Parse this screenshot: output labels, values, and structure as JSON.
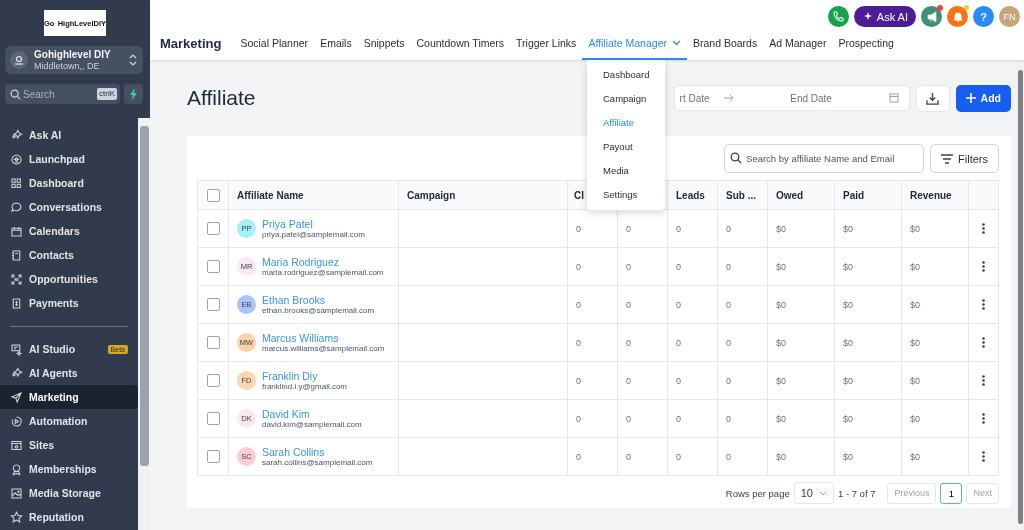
{
  "sidebar": {
    "logo": {
      "left": "Go",
      "right": "HighLevelDIY"
    },
    "account": {
      "name": "Gohighlevel DIY",
      "location": "Middletown,, DE"
    },
    "search": {
      "placeholder": "Search",
      "shortcut": "ctrlK"
    },
    "groups": [
      [
        {
          "label": "Ask AI",
          "selected": false
        },
        {
          "label": "Launchpad",
          "selected": false
        },
        {
          "label": "Dashboard",
          "selected": false
        },
        {
          "label": "Conversations",
          "selected": false
        },
        {
          "label": "Calendars",
          "selected": false
        },
        {
          "label": "Contacts",
          "selected": false
        },
        {
          "label": "Opportunities",
          "selected": false
        },
        {
          "label": "Payments",
          "selected": false
        }
      ],
      [
        {
          "label": "AI Studio",
          "selected": false,
          "badge": "Beta"
        },
        {
          "label": "AI Agents",
          "selected": false
        },
        {
          "label": "Marketing",
          "selected": true
        },
        {
          "label": "Automation",
          "selected": false
        },
        {
          "label": "Sites",
          "selected": false
        },
        {
          "label": "Memberships",
          "selected": false
        },
        {
          "label": "Media Storage",
          "selected": false
        },
        {
          "label": "Reputation",
          "selected": false
        }
      ]
    ]
  },
  "topbar": {
    "ask_ai": "Ask AI",
    "help": "?",
    "avatar": "FN",
    "notifications": [
      {
        "kind": "megaphone",
        "unread": true
      },
      {
        "kind": "bell",
        "unread": true
      }
    ]
  },
  "nav": {
    "title": "Marketing",
    "tabs": [
      {
        "label": "Social Planner",
        "selected": false
      },
      {
        "label": "Emails",
        "selected": false
      },
      {
        "label": "Snippets",
        "selected": false
      },
      {
        "label": "Countdown Timers",
        "selected": false
      },
      {
        "label": "Trigger Links",
        "selected": false
      },
      {
        "label": "Affiliate Manager",
        "selected": true,
        "dropdown": true
      },
      {
        "label": "Brand Boards",
        "selected": false
      },
      {
        "label": "Ad Manager",
        "selected": false
      },
      {
        "label": "Prospecting",
        "selected": false
      }
    ]
  },
  "dropdown_menu": [
    {
      "label": "Dashboard",
      "selected": false
    },
    {
      "label": "Campaign",
      "selected": false
    },
    {
      "label": "Affiliate",
      "selected": true
    },
    {
      "label": "Payout",
      "selected": false
    },
    {
      "label": "Media",
      "selected": false
    },
    {
      "label": "Settings",
      "selected": false
    }
  ],
  "page": {
    "title": "Affiliate",
    "start_date": "rt Date",
    "end_date": "End Date",
    "add_button": "Add"
  },
  "table": {
    "search": {
      "placeholder": "Search by affiliate Name and Email"
    },
    "filters": "Filters",
    "header_checked": false,
    "name_column": "Affiliate Name",
    "columns": [
      "Campaign",
      "Cl",
      "",
      "Leads",
      "Sub ...",
      "Owed",
      "Paid",
      "Revenue"
    ],
    "rows": [
      {
        "initials": "PP",
        "color": "#a5effa",
        "name": "Priya Patel",
        "email": "priya.patel@samplemail.com",
        "checked": false,
        "cells": [
          "",
          "0",
          "0",
          "0",
          "0",
          "$0",
          "$0",
          "$0"
        ]
      },
      {
        "initials": "MR",
        "color": "#fce7f3",
        "name": "Maria Rodriguez",
        "email": "maria.rodriguez@samplemail.com",
        "checked": false,
        "cells": [
          "",
          "0",
          "0",
          "0",
          "0",
          "$0",
          "$0",
          "$0"
        ]
      },
      {
        "initials": "EB",
        "color": "#a9c5fa",
        "name": "Ethan Brooks",
        "email": "ethan.brooks@samplemail.com",
        "checked": false,
        "cells": [
          "",
          "0",
          "0",
          "0",
          "0",
          "$0",
          "$0",
          "$0"
        ]
      },
      {
        "initials": "MW",
        "color": "#fdd2a7",
        "name": "Marcus Williams",
        "email": "marcus.williams@samplemail.com",
        "checked": false,
        "cells": [
          "",
          "0",
          "0",
          "0",
          "0",
          "$0",
          "$0",
          "$0"
        ]
      },
      {
        "initials": "FD",
        "color": "#fdd6ad",
        "name": "Franklin Diy",
        "email": "franklind.i.y@gmail.com",
        "checked": false,
        "cells": [
          "",
          "0",
          "0",
          "0",
          "0",
          "$0",
          "$0",
          "$0"
        ]
      },
      {
        "initials": "DK",
        "color": "#fde8f2",
        "name": "David Kim",
        "email": "david.kim@samplemail.com",
        "checked": false,
        "cells": [
          "",
          "0",
          "0",
          "0",
          "0",
          "$0",
          "$0",
          "$0"
        ]
      },
      {
        "initials": "SC",
        "color": "#fecdd3",
        "name": "Sarah Collins",
        "email": "sarah.collins@samplemail.com",
        "checked": false,
        "cells": [
          "",
          "0",
          "0",
          "0",
          "0",
          "$0",
          "$0",
          "$0"
        ]
      }
    ]
  },
  "pagination": {
    "rows_label": "Rows per page",
    "rows_per_page": "10",
    "range": "1 - 7 of 7",
    "previous": {
      "label": "Previous",
      "disabled": true
    },
    "pages": [
      {
        "label": "1",
        "selected": true
      }
    ],
    "next": {
      "label": "Next",
      "disabled": true
    }
  }
}
